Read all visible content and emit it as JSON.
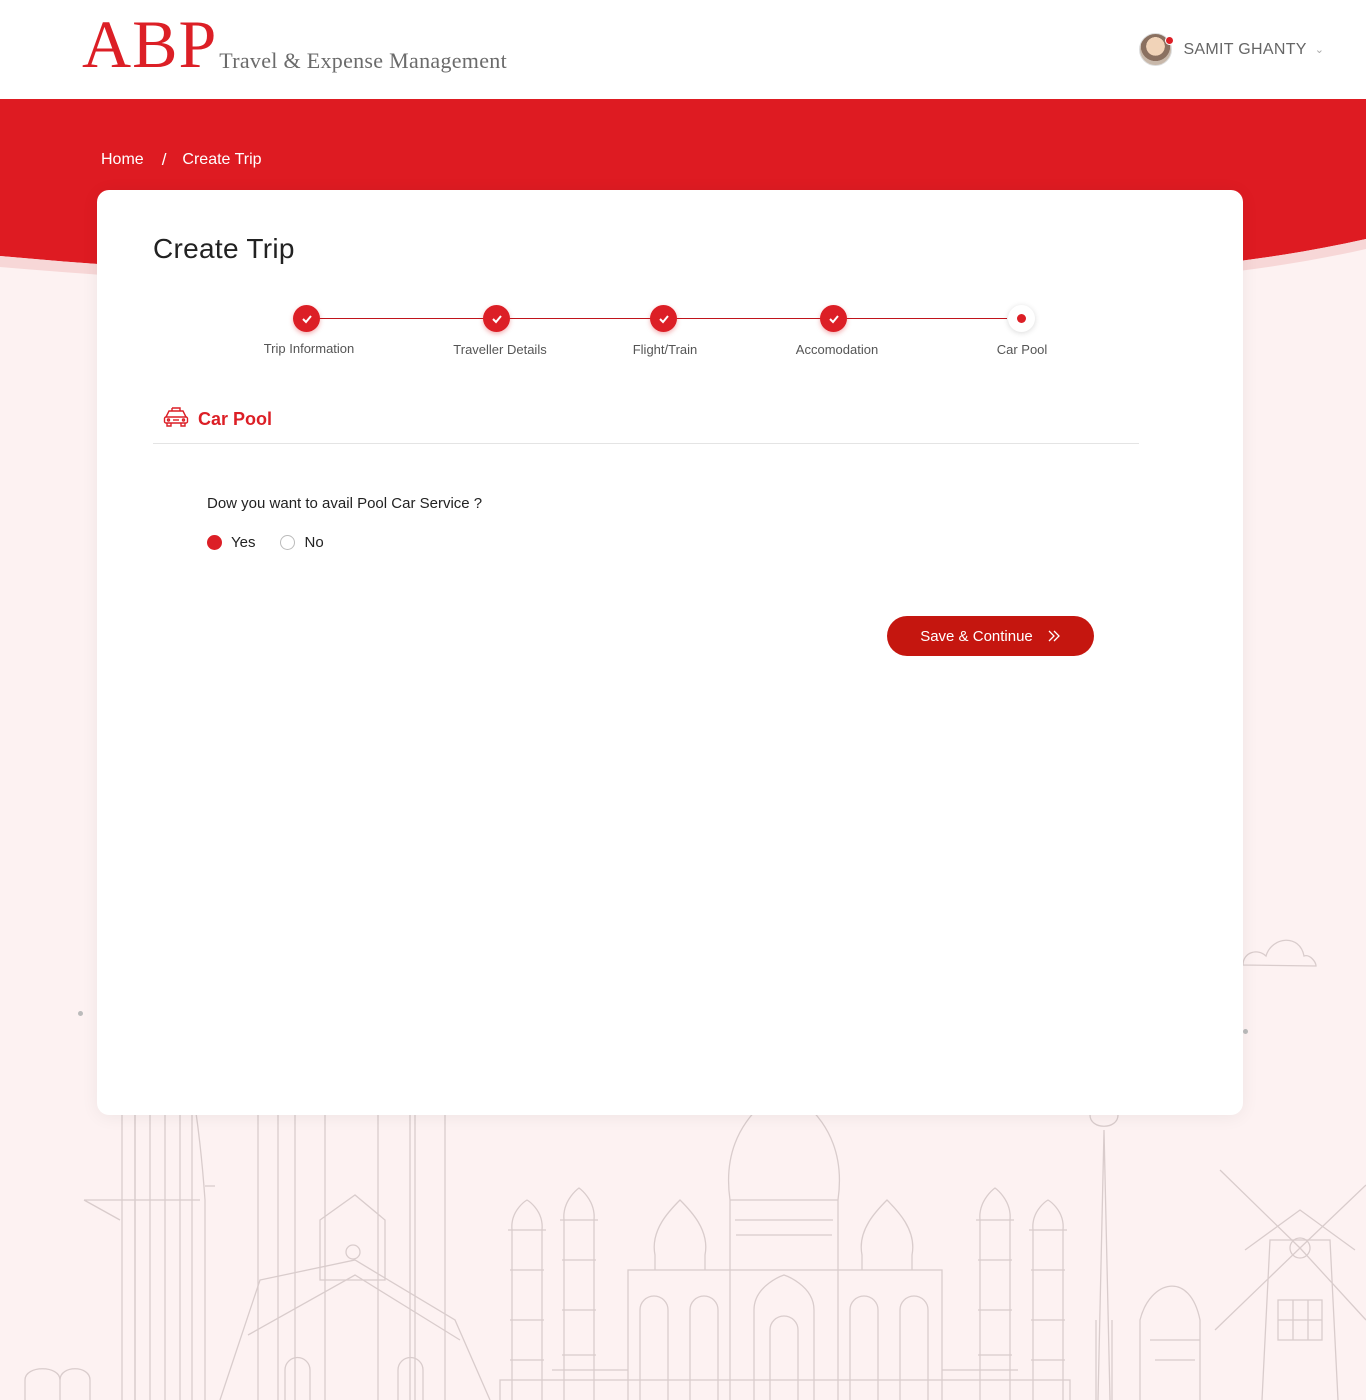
{
  "header": {
    "logo_main": "ABP",
    "logo_sub": "Travel & Expense Management",
    "user_name": "SAMIT GHANTY"
  },
  "breadcrumb": {
    "home": "Home",
    "separator": "/",
    "current": "Create Trip"
  },
  "page": {
    "title": "Create Trip"
  },
  "stepper": {
    "steps": [
      {
        "label": "Trip Information",
        "status": "done"
      },
      {
        "label": "Traveller Details",
        "status": "done"
      },
      {
        "label": "Flight/Train",
        "status": "done"
      },
      {
        "label": "Accomodation",
        "status": "done"
      },
      {
        "label": "Car Pool",
        "status": "current"
      }
    ]
  },
  "section": {
    "title": "Car Pool",
    "icon": "car-icon"
  },
  "form": {
    "question": "Dow you want to avail Pool Car Service ?",
    "options": [
      {
        "label": "Yes",
        "checked": true
      },
      {
        "label": "No",
        "checked": false
      }
    ]
  },
  "actions": {
    "save_label": "Save & Continue"
  },
  "colors": {
    "brand_red": "#dc1f26",
    "button_red": "#c5160f",
    "background": "#fdf2f2"
  }
}
